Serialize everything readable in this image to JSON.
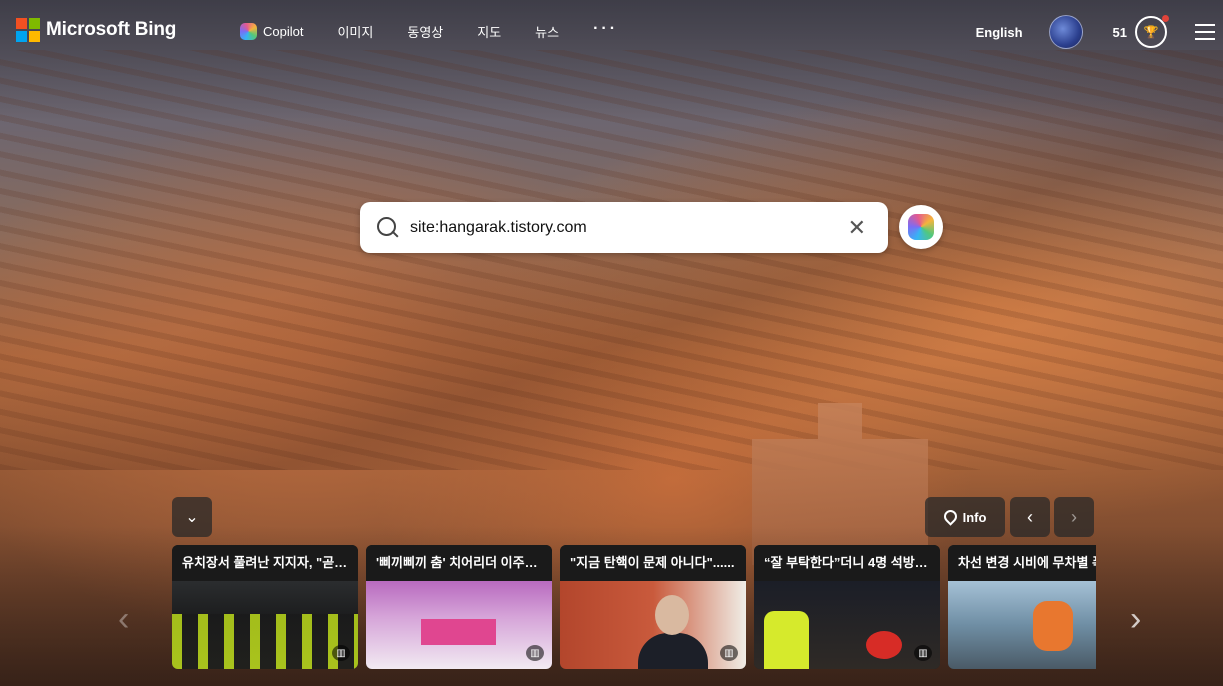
{
  "header": {
    "logo_text": "Microsoft Bing",
    "nav": [
      {
        "label": "Copilot"
      },
      {
        "label": "이미지"
      },
      {
        "label": "동영상"
      },
      {
        "label": "지도"
      },
      {
        "label": "뉴스"
      },
      {
        "label": "···"
      }
    ],
    "language": "English",
    "points": "51"
  },
  "search": {
    "value": "site:hangarak.tistory.com"
  },
  "controls": {
    "info_label": "Info"
  },
  "news": [
    {
      "title": "유치장서 풀려난 지지자, \"곧 ..."
    },
    {
      "title": "'삐끼삐끼 춤' 치어리더 이주은..."
    },
    {
      "title": "\"지금 탄핵이 문제 아니다\"......"
    },
    {
      "title": "“잘 부탁한다”더니 4명 석방......"
    },
    {
      "title": "차선 변경 시비에 무차별 폭"
    }
  ],
  "colors": {
    "ms_red": "#f25022",
    "ms_green": "#7fba00",
    "ms_blue": "#00a4ef",
    "ms_yellow": "#ffb900",
    "notification_dot": "#e0433a"
  }
}
